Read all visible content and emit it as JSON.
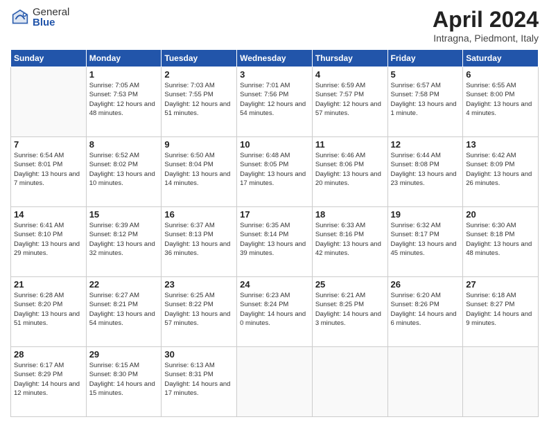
{
  "logo": {
    "general": "General",
    "blue": "Blue"
  },
  "header": {
    "title": "April 2024",
    "subtitle": "Intragna, Piedmont, Italy"
  },
  "days_of_week": [
    "Sunday",
    "Monday",
    "Tuesday",
    "Wednesday",
    "Thursday",
    "Friday",
    "Saturday"
  ],
  "weeks": [
    [
      {
        "day": "",
        "sunrise": "",
        "sunset": "",
        "daylight": ""
      },
      {
        "day": "1",
        "sunrise": "Sunrise: 7:05 AM",
        "sunset": "Sunset: 7:53 PM",
        "daylight": "Daylight: 12 hours and 48 minutes."
      },
      {
        "day": "2",
        "sunrise": "Sunrise: 7:03 AM",
        "sunset": "Sunset: 7:55 PM",
        "daylight": "Daylight: 12 hours and 51 minutes."
      },
      {
        "day": "3",
        "sunrise": "Sunrise: 7:01 AM",
        "sunset": "Sunset: 7:56 PM",
        "daylight": "Daylight: 12 hours and 54 minutes."
      },
      {
        "day": "4",
        "sunrise": "Sunrise: 6:59 AM",
        "sunset": "Sunset: 7:57 PM",
        "daylight": "Daylight: 12 hours and 57 minutes."
      },
      {
        "day": "5",
        "sunrise": "Sunrise: 6:57 AM",
        "sunset": "Sunset: 7:58 PM",
        "daylight": "Daylight: 13 hours and 1 minute."
      },
      {
        "day": "6",
        "sunrise": "Sunrise: 6:55 AM",
        "sunset": "Sunset: 8:00 PM",
        "daylight": "Daylight: 13 hours and 4 minutes."
      }
    ],
    [
      {
        "day": "7",
        "sunrise": "Sunrise: 6:54 AM",
        "sunset": "Sunset: 8:01 PM",
        "daylight": "Daylight: 13 hours and 7 minutes."
      },
      {
        "day": "8",
        "sunrise": "Sunrise: 6:52 AM",
        "sunset": "Sunset: 8:02 PM",
        "daylight": "Daylight: 13 hours and 10 minutes."
      },
      {
        "day": "9",
        "sunrise": "Sunrise: 6:50 AM",
        "sunset": "Sunset: 8:04 PM",
        "daylight": "Daylight: 13 hours and 14 minutes."
      },
      {
        "day": "10",
        "sunrise": "Sunrise: 6:48 AM",
        "sunset": "Sunset: 8:05 PM",
        "daylight": "Daylight: 13 hours and 17 minutes."
      },
      {
        "day": "11",
        "sunrise": "Sunrise: 6:46 AM",
        "sunset": "Sunset: 8:06 PM",
        "daylight": "Daylight: 13 hours and 20 minutes."
      },
      {
        "day": "12",
        "sunrise": "Sunrise: 6:44 AM",
        "sunset": "Sunset: 8:08 PM",
        "daylight": "Daylight: 13 hours and 23 minutes."
      },
      {
        "day": "13",
        "sunrise": "Sunrise: 6:42 AM",
        "sunset": "Sunset: 8:09 PM",
        "daylight": "Daylight: 13 hours and 26 minutes."
      }
    ],
    [
      {
        "day": "14",
        "sunrise": "Sunrise: 6:41 AM",
        "sunset": "Sunset: 8:10 PM",
        "daylight": "Daylight: 13 hours and 29 minutes."
      },
      {
        "day": "15",
        "sunrise": "Sunrise: 6:39 AM",
        "sunset": "Sunset: 8:12 PM",
        "daylight": "Daylight: 13 hours and 32 minutes."
      },
      {
        "day": "16",
        "sunrise": "Sunrise: 6:37 AM",
        "sunset": "Sunset: 8:13 PM",
        "daylight": "Daylight: 13 hours and 36 minutes."
      },
      {
        "day": "17",
        "sunrise": "Sunrise: 6:35 AM",
        "sunset": "Sunset: 8:14 PM",
        "daylight": "Daylight: 13 hours and 39 minutes."
      },
      {
        "day": "18",
        "sunrise": "Sunrise: 6:33 AM",
        "sunset": "Sunset: 8:16 PM",
        "daylight": "Daylight: 13 hours and 42 minutes."
      },
      {
        "day": "19",
        "sunrise": "Sunrise: 6:32 AM",
        "sunset": "Sunset: 8:17 PM",
        "daylight": "Daylight: 13 hours and 45 minutes."
      },
      {
        "day": "20",
        "sunrise": "Sunrise: 6:30 AM",
        "sunset": "Sunset: 8:18 PM",
        "daylight": "Daylight: 13 hours and 48 minutes."
      }
    ],
    [
      {
        "day": "21",
        "sunrise": "Sunrise: 6:28 AM",
        "sunset": "Sunset: 8:20 PM",
        "daylight": "Daylight: 13 hours and 51 minutes."
      },
      {
        "day": "22",
        "sunrise": "Sunrise: 6:27 AM",
        "sunset": "Sunset: 8:21 PM",
        "daylight": "Daylight: 13 hours and 54 minutes."
      },
      {
        "day": "23",
        "sunrise": "Sunrise: 6:25 AM",
        "sunset": "Sunset: 8:22 PM",
        "daylight": "Daylight: 13 hours and 57 minutes."
      },
      {
        "day": "24",
        "sunrise": "Sunrise: 6:23 AM",
        "sunset": "Sunset: 8:24 PM",
        "daylight": "Daylight: 14 hours and 0 minutes."
      },
      {
        "day": "25",
        "sunrise": "Sunrise: 6:21 AM",
        "sunset": "Sunset: 8:25 PM",
        "daylight": "Daylight: 14 hours and 3 minutes."
      },
      {
        "day": "26",
        "sunrise": "Sunrise: 6:20 AM",
        "sunset": "Sunset: 8:26 PM",
        "daylight": "Daylight: 14 hours and 6 minutes."
      },
      {
        "day": "27",
        "sunrise": "Sunrise: 6:18 AM",
        "sunset": "Sunset: 8:27 PM",
        "daylight": "Daylight: 14 hours and 9 minutes."
      }
    ],
    [
      {
        "day": "28",
        "sunrise": "Sunrise: 6:17 AM",
        "sunset": "Sunset: 8:29 PM",
        "daylight": "Daylight: 14 hours and 12 minutes."
      },
      {
        "day": "29",
        "sunrise": "Sunrise: 6:15 AM",
        "sunset": "Sunset: 8:30 PM",
        "daylight": "Daylight: 14 hours and 15 minutes."
      },
      {
        "day": "30",
        "sunrise": "Sunrise: 6:13 AM",
        "sunset": "Sunset: 8:31 PM",
        "daylight": "Daylight: 14 hours and 17 minutes."
      },
      {
        "day": "",
        "sunrise": "",
        "sunset": "",
        "daylight": ""
      },
      {
        "day": "",
        "sunrise": "",
        "sunset": "",
        "daylight": ""
      },
      {
        "day": "",
        "sunrise": "",
        "sunset": "",
        "daylight": ""
      },
      {
        "day": "",
        "sunrise": "",
        "sunset": "",
        "daylight": ""
      }
    ]
  ]
}
